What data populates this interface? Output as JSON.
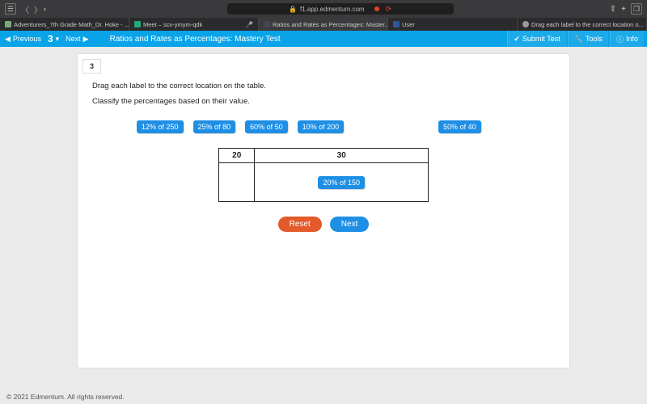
{
  "browser": {
    "url": "f1.app.edmentum.com",
    "tabs": [
      {
        "label": "Adventurers_7th Grade Math_Dr. Hoke - ..."
      },
      {
        "label": "Meet – scx-ymym-qdk"
      },
      {
        "label": "Ratios and Rates as Percentages: Master..."
      },
      {
        "label": "User"
      },
      {
        "label": "Drag each label to the correct location o..."
      }
    ]
  },
  "appbar": {
    "previous": "Previous",
    "question_indicator": "3",
    "next": "Next",
    "title": "Ratios and Rates as Percentages: Mastery Test",
    "submit": "Submit Test",
    "tools": "Tools",
    "info": "Info"
  },
  "question": {
    "number": "3",
    "instruction": "Drag each label to the correct location on the table.",
    "sub_instruction": "Classify the percentages based on their value.",
    "chips": [
      "12% of 250",
      "25% of 80",
      "60% of 50",
      "10% of 200",
      "50% of 40"
    ],
    "table": {
      "headers": [
        "20",
        "30"
      ],
      "placed_col2": "20% of 150"
    },
    "buttons": {
      "reset": "Reset",
      "next": "Next"
    }
  },
  "footer": "© 2021 Edmentum. All rights reserved."
}
